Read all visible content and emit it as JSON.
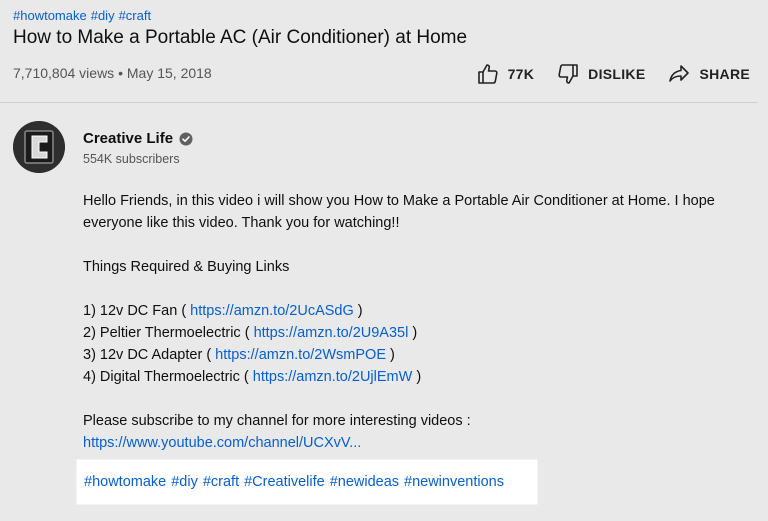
{
  "top_tags": [
    "#howtomake",
    "#diy",
    "#craft"
  ],
  "video": {
    "title": "How to Make a Portable AC (Air Conditioner) at Home",
    "views": "7,710,804 views",
    "separator": "•",
    "date": "May 15, 2018"
  },
  "actions": {
    "like_count": "77K",
    "dislike_label": "DISLIKE",
    "share_label": "SHARE"
  },
  "channel": {
    "name": "Creative Life",
    "subscribers": "554K subscribers",
    "verified_icon": "verified-check-icon",
    "avatar_letter": "C"
  },
  "description": {
    "intro_1": "Hello Friends, in this video i will show you How to Make a Portable Air Conditioner at Home. I hope",
    "intro_2": "everyone like this video. Thank you for watching!!",
    "things_heading": "Things Required & Buying Links",
    "items": [
      {
        "prefix": "1) 12v DC Fan ( ",
        "link": "https://amzn.to/2UcASdG",
        "suffix": " )"
      },
      {
        "prefix": "2) Peltier Thermoelectric ( ",
        "link": "https://amzn.to/2U9A35l",
        "suffix": " )"
      },
      {
        "prefix": "3) 12v DC Adapter ( ",
        "link": "https://amzn.to/2WsmPOE",
        "suffix": " )"
      },
      {
        "prefix": "4) Digital Thermoelectric ( ",
        "link": "https://amzn.to/2UjlEmW",
        "suffix": " )"
      }
    ],
    "subscribe_text": "Please subscribe to my channel for more interesting videos :",
    "channel_link": "https://www.youtube.com/channel/UCXvV..."
  },
  "hashtags": [
    "#howtomake",
    "#diy",
    "#craft",
    "#Creativelife",
    "#newideas",
    "#newinventions"
  ],
  "colors": {
    "link": "#065fd4",
    "background": "#e9e9e9",
    "highlight_box": "#ffffff"
  }
}
